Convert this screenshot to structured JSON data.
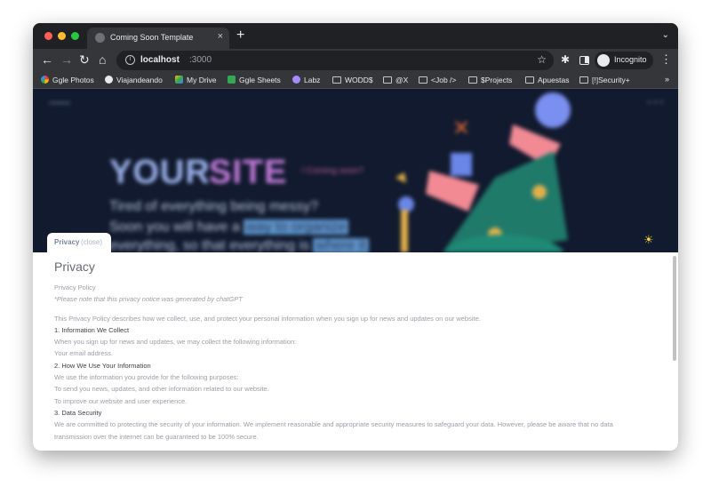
{
  "browser": {
    "tab_title": "Coming Soon Template",
    "tab_close": "×",
    "new_tab": "+",
    "url_host": "localhost",
    "url_port": ":3000",
    "profile_label": "Incognito"
  },
  "bookmarks": {
    "items": [
      "Ggle Photos",
      "Viajandeando",
      "My Drive",
      "Ggle Sheets",
      "Labz",
      "WODD$",
      "@X",
      "<Job />",
      "$Projects",
      "Apuestas",
      "[!]Security+"
    ],
    "more": "»"
  },
  "hero": {
    "title_part1": "YOUR",
    "title_part2": "SITE",
    "subtitle": "/ Coming soon?",
    "line1": "Tired of everything being messy?",
    "line2_prefix": "Soon you will have a",
    "line2_highlight": "way to organize",
    "line3_prefix": "everything, so that everything is",
    "line3_highlight": "where it"
  },
  "privacy_tab": {
    "label": "Privacy",
    "close": "(close)"
  },
  "privacy": {
    "heading": "Privacy",
    "policy_title": "Privacy Policy",
    "note": "*Please note that this privacy notice was generated by chatGPT",
    "intro": "This Privacy Policy describes how we collect, use, and protect your personal information when you sign up for news and updates on our website.",
    "s1_title": "1. Information We Collect",
    "s1_p1": "When you sign up for news and updates, we may collect the following information:",
    "s1_p2": "Your email address.",
    "s2_title": "2. How We Use Your Information",
    "s2_p1": "We use the information you provide for the following purposes:",
    "s2_p2": "To send you news, updates, and other information related to our website.",
    "s2_p3": "To improve our website and user experience.",
    "s3_title": "3. Data Security",
    "s3_p1": "We are committed to protecting the security of your information. We implement reasonable and appropriate security measures to safeguard your data. However, please be aware that no data transmission over the internet can be guaranteed to be 100% secure."
  },
  "colors": {
    "hero_bg": "#111a2e",
    "title_blue": "#9cb2ea",
    "title_purple": "#c27ad8",
    "accent_pink": "#c45aa6"
  }
}
